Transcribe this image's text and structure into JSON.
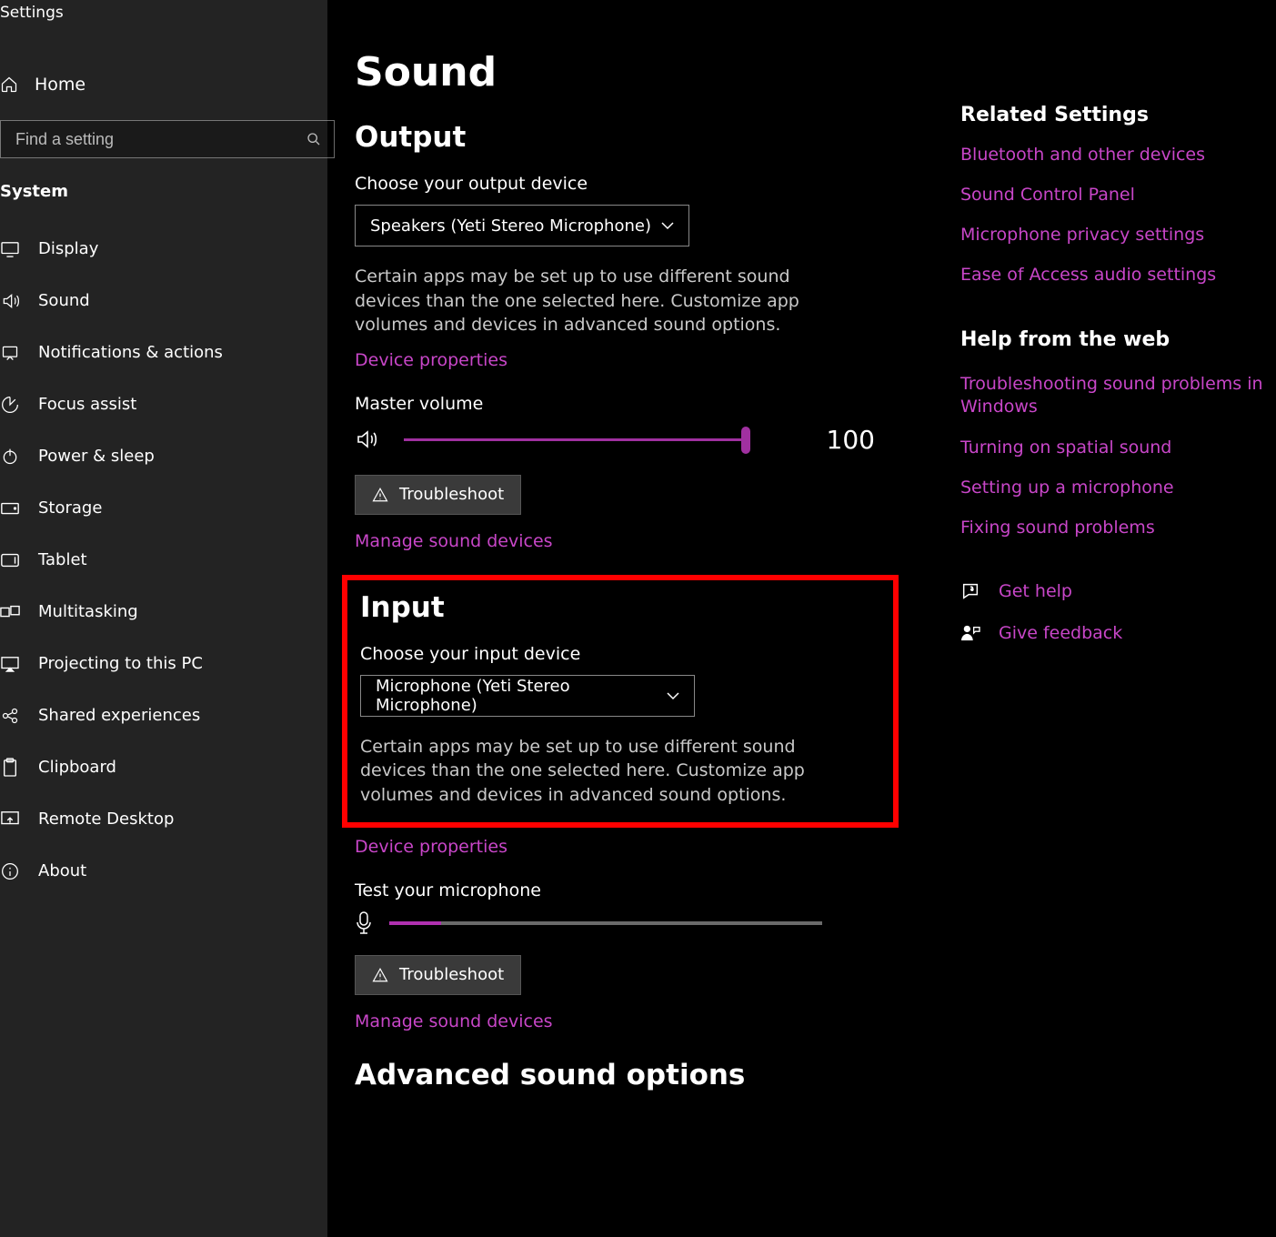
{
  "window_title": "Settings",
  "sidebar": {
    "home": "Home",
    "search_placeholder": "Find a setting",
    "category": "System",
    "items": [
      {
        "icon": "display",
        "label": "Display"
      },
      {
        "icon": "sound",
        "label": "Sound"
      },
      {
        "icon": "notifications",
        "label": "Notifications & actions"
      },
      {
        "icon": "focus",
        "label": "Focus assist"
      },
      {
        "icon": "power",
        "label": "Power & sleep"
      },
      {
        "icon": "storage",
        "label": "Storage"
      },
      {
        "icon": "tablet",
        "label": "Tablet"
      },
      {
        "icon": "multitasking",
        "label": "Multitasking"
      },
      {
        "icon": "projecting",
        "label": "Projecting to this PC"
      },
      {
        "icon": "shared",
        "label": "Shared experiences"
      },
      {
        "icon": "clipboard",
        "label": "Clipboard"
      },
      {
        "icon": "remote",
        "label": "Remote Desktop"
      },
      {
        "icon": "about",
        "label": "About"
      }
    ]
  },
  "page": {
    "title": "Sound",
    "output": {
      "heading": "Output",
      "choose": "Choose your output device",
      "device": "Speakers (Yeti Stereo Microphone)",
      "desc": "Certain apps may be set up to use different sound devices than the one selected here. Customize app volumes and devices in advanced sound options.",
      "props": "Device properties",
      "master": "Master volume",
      "volume": "100",
      "volume_pct": 100,
      "troubleshoot": "Troubleshoot",
      "manage": "Manage sound devices"
    },
    "input": {
      "heading": "Input",
      "choose": "Choose your input device",
      "device": "Microphone (Yeti Stereo Microphone)",
      "desc": "Certain apps may be set up to use different sound devices than the one selected here. Customize app volumes and devices in advanced sound options.",
      "props": "Device properties",
      "test": "Test your microphone",
      "mic_level_pct": 12,
      "troubleshoot": "Troubleshoot",
      "manage": "Manage sound devices"
    },
    "advanced_heading": "Advanced sound options"
  },
  "right": {
    "related_heading": "Related Settings",
    "related": [
      "Bluetooth and other devices",
      "Sound Control Panel",
      "Microphone privacy settings",
      "Ease of Access audio settings"
    ],
    "help_heading": "Help from the web",
    "help": [
      "Troubleshooting sound problems in Windows",
      "Turning on spatial sound",
      "Setting up a microphone",
      "Fixing sound problems"
    ],
    "get_help": "Get help",
    "feedback": "Give feedback"
  }
}
